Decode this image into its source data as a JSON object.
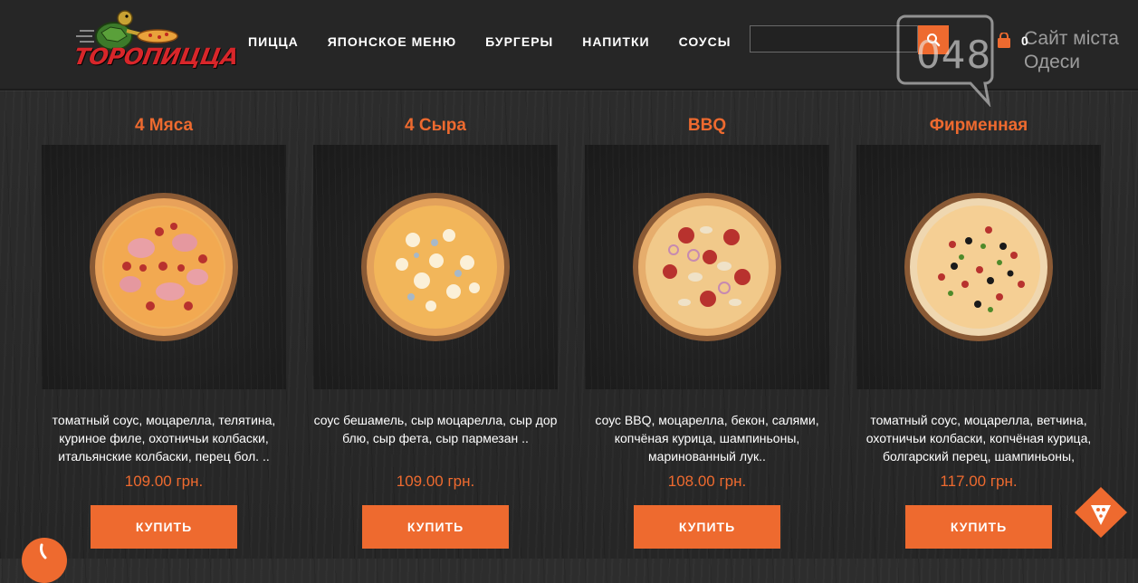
{
  "header": {
    "logo_text": "ТОРОПИЦЦА",
    "nav": [
      "ПИЦЦА",
      "ЯПОНСКОЕ МЕНЮ",
      "БУРГЕРЫ",
      "НАПИТКИ",
      "СОУСЫ"
    ],
    "search": {
      "placeholder": "",
      "value": "",
      "icon": "search-icon"
    },
    "cart": {
      "icon": "cart-icon",
      "count": "0"
    }
  },
  "watermark": {
    "number": "048",
    "line1": "Сайт міста",
    "line2": "Одеси"
  },
  "products": [
    {
      "name": "4 Мяса",
      "description": "томатный соус, моцарелла, телятина, куриное филе, охотничьи колбаски, итальянские колбаски, перец бол. ..",
      "price": "109.00 грн.",
      "buy_label": "КУПИТЬ"
    },
    {
      "name": "4 Сыра",
      "description": "соус бешамель, сыр моцарелла, сыр дор блю, сыр фета, сыр пармезан ..",
      "price": "109.00 грн.",
      "buy_label": "КУПИТЬ"
    },
    {
      "name": "BBQ",
      "description": "соус BBQ, моцарелла, бекон, салями, копчёная курица, шампиньоны, маринованный лук..",
      "price": "108.00 грн.",
      "buy_label": "КУПИТЬ"
    },
    {
      "name": "Фирменная",
      "description": "томатный соус, моцарелла, ветчина, охотничьи колбаски, копчёная курица, болгарский перец, шампиньоны,",
      "price": "117.00 грн.",
      "buy_label": "КУПИТЬ"
    }
  ],
  "colors": {
    "accent": "#ee6a2f",
    "background": "#2a2a2a",
    "text": "#ffffff",
    "logo_red": "#d8262a"
  }
}
